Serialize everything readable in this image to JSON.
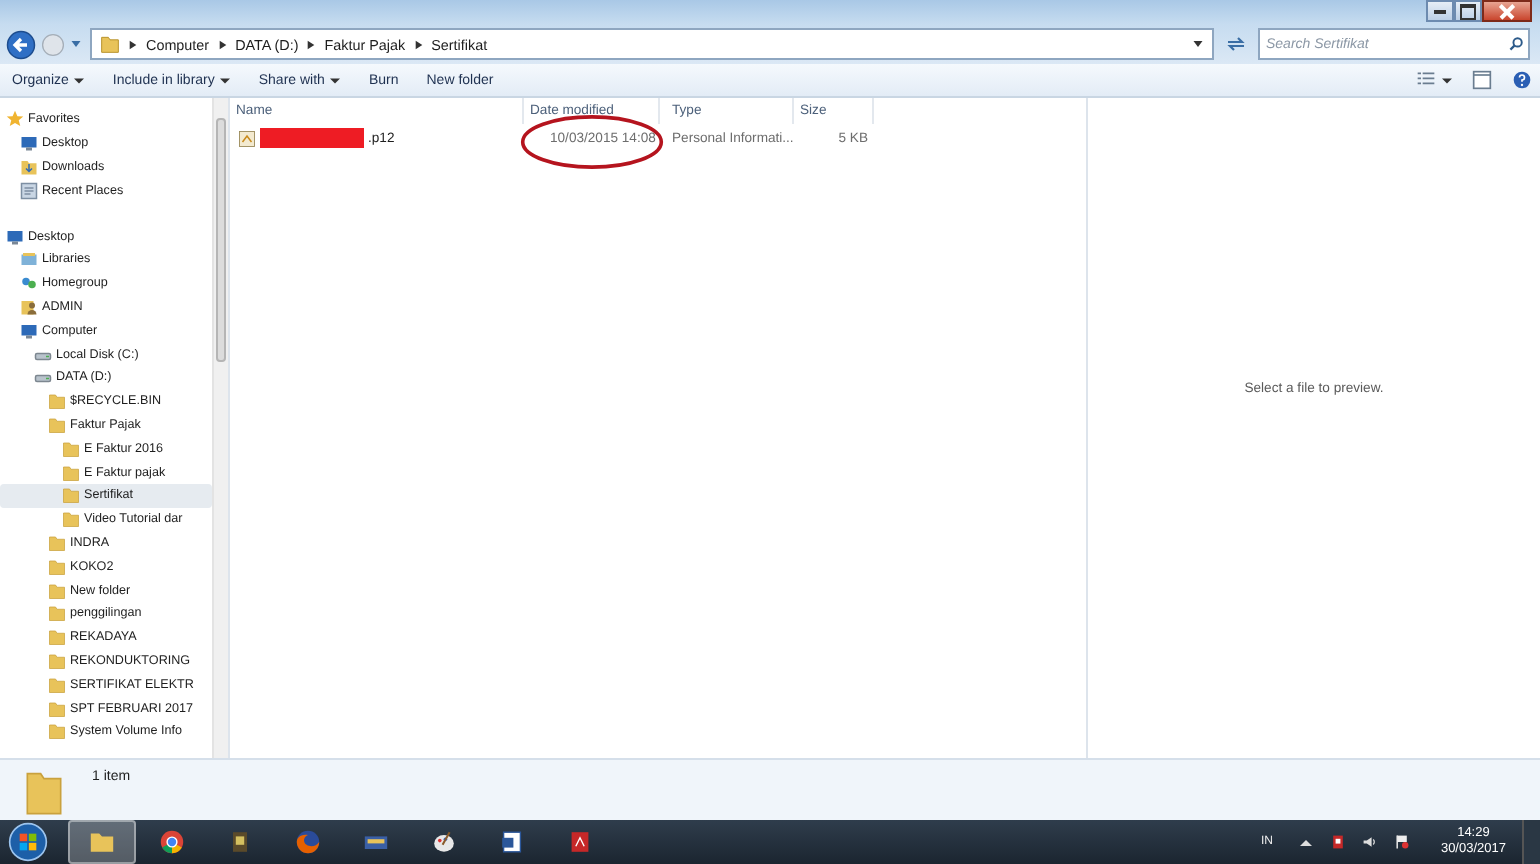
{
  "address_bar": {
    "crumbs": [
      "Computer",
      "DATA (D:)",
      "Faktur Pajak",
      "Sertifikat"
    ]
  },
  "search": {
    "placeholder": "Search Sertifikat"
  },
  "toolbar": {
    "buttons": [
      {
        "label": "Organize",
        "dropdown": true
      },
      {
        "label": "Include in library",
        "dropdown": true
      },
      {
        "label": "Share with",
        "dropdown": true
      },
      {
        "label": "Burn",
        "dropdown": false
      },
      {
        "label": "New folder",
        "dropdown": false
      }
    ]
  },
  "sidebar": {
    "items": [
      {
        "label": "Favorites",
        "kind": "star",
        "selected": false,
        "children": [
          {
            "label": "Desktop",
            "kind": "desktop",
            "selected": false
          },
          {
            "label": "Downloads",
            "kind": "download",
            "selected": false
          },
          {
            "label": "Recent Places",
            "kind": "recent",
            "selected": false
          }
        ]
      },
      {
        "label": "Desktop",
        "kind": "desktop",
        "selected": false,
        "children": [
          {
            "label": "Libraries",
            "kind": "library",
            "selected": false
          },
          {
            "label": "Homegroup",
            "kind": "homegroup",
            "selected": false
          },
          {
            "label": "ADMIN",
            "kind": "user",
            "selected": false
          },
          {
            "label": "Computer",
            "kind": "computer",
            "selected": false,
            "children": [
              {
                "label": "Local Disk (C:)",
                "kind": "drive",
                "selected": false
              },
              {
                "label": "DATA (D:)",
                "kind": "drive",
                "selected": false,
                "children": [
                  {
                    "label": "$RECYCLE.BIN",
                    "kind": "folder",
                    "selected": false
                  },
                  {
                    "label": "Faktur Pajak",
                    "kind": "folder",
                    "selected": false,
                    "children": [
                      {
                        "label": "E Faktur 2016",
                        "kind": "folder",
                        "selected": false
                      },
                      {
                        "label": "E Faktur pajak",
                        "kind": "folder",
                        "selected": false
                      },
                      {
                        "label": "Sertifikat",
                        "kind": "folder",
                        "selected": true
                      },
                      {
                        "label": "Video Tutorial dar",
                        "kind": "folder",
                        "selected": false
                      }
                    ]
                  },
                  {
                    "label": "INDRA",
                    "kind": "folder",
                    "selected": false
                  },
                  {
                    "label": "KOKO2",
                    "kind": "folder",
                    "selected": false
                  },
                  {
                    "label": "New folder",
                    "kind": "folder",
                    "selected": false
                  },
                  {
                    "label": "penggilingan",
                    "kind": "folder",
                    "selected": false
                  },
                  {
                    "label": "REKADAYA",
                    "kind": "folder",
                    "selected": false
                  },
                  {
                    "label": "REKONDUKTORING",
                    "kind": "folder",
                    "selected": false
                  },
                  {
                    "label": "SERTIFIKAT ELEKTR",
                    "kind": "folder",
                    "selected": false
                  },
                  {
                    "label": "SPT FEBRUARI 2017",
                    "kind": "folder",
                    "selected": false
                  },
                  {
                    "label": "System Volume Info",
                    "kind": "folder",
                    "selected": false
                  }
                ]
              }
            ]
          }
        ]
      }
    ]
  },
  "file_list": {
    "columns": [
      "Name",
      "Date modified",
      "Type",
      "Size"
    ],
    "rows": [
      {
        "name": ".p12",
        "name_redacted": true,
        "date_modified": "10/03/2015 14:08",
        "date_circled": true,
        "type": "Personal Informati...",
        "size": "5 KB",
        "selected": false
      }
    ]
  },
  "preview": {
    "message": "Select a file to preview."
  },
  "details_pane": {
    "summary": "1 item"
  },
  "taskbar": {
    "language": "IN",
    "time": "14:29",
    "date": "30/03/2017"
  }
}
